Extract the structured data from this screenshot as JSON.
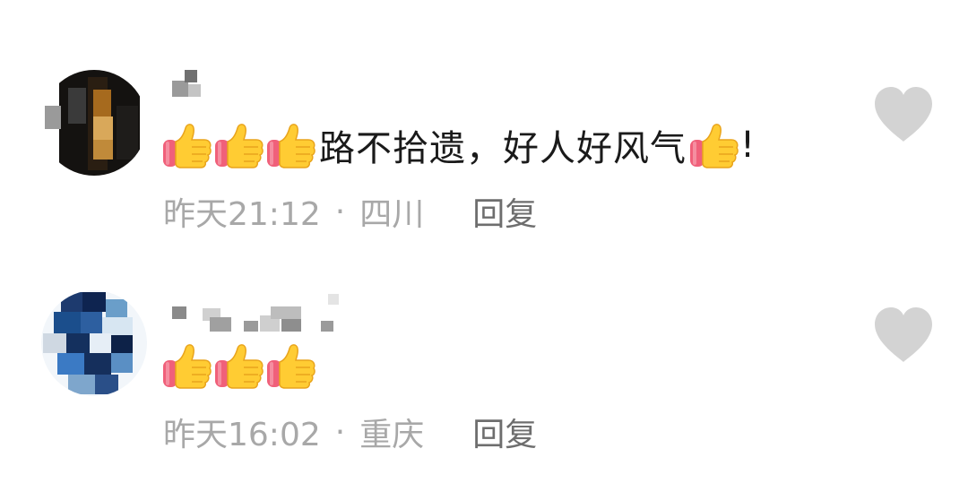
{
  "comments": [
    {
      "time": "昨天21:12",
      "separator": "·",
      "location": "四川",
      "text": "路不拾遗，好人好风气",
      "text_suffix": "!",
      "reply_label": "回复"
    },
    {
      "time": "昨天16:02",
      "separator": "·",
      "location": "重庆",
      "reply_label": "回复"
    }
  ],
  "icons": {
    "thumbs_up": "thumbs-up-emoji",
    "like": "heart-icon"
  },
  "colors": {
    "text": "#1a1a1a",
    "meta": "#a8a8a8",
    "reply": "#6e6e6e",
    "heart": "#d3d3d3",
    "thumb_yellow": "#ffcc33",
    "cuff_red": "#f0607a"
  }
}
